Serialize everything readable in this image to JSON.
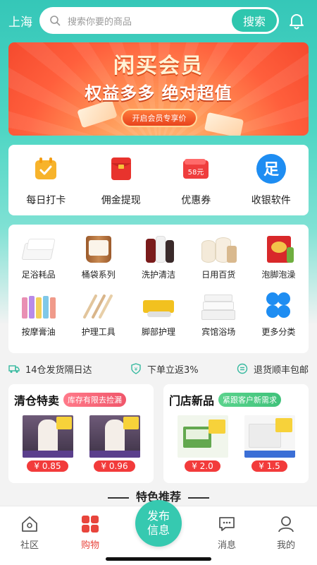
{
  "header": {
    "city": "上海",
    "search_placeholder": "搜索你要的商品",
    "search_button": "搜索"
  },
  "banner": {
    "title": "闲买会员",
    "subtitle": "权益多多 绝对超值",
    "button": "开启会员专享价"
  },
  "quick_actions": [
    {
      "label": "每日打卡",
      "icon": "calendar-check-icon"
    },
    {
      "label": "佣金提现",
      "icon": "red-envelope-icon"
    },
    {
      "label": "优惠券",
      "icon": "coupon-icon",
      "badge": "58元"
    },
    {
      "label": "收银软件",
      "icon": "cashier-icon",
      "badge": "足"
    }
  ],
  "categories": [
    {
      "label": "足浴耗品"
    },
    {
      "label": "桶袋系列"
    },
    {
      "label": "洗护清洁"
    },
    {
      "label": "日用百货"
    },
    {
      "label": "泡脚泡澡"
    },
    {
      "label": "按摩膏油"
    },
    {
      "label": "护理工具"
    },
    {
      "label": "脚部护理"
    },
    {
      "label": "宾馆浴场"
    },
    {
      "label": "更多分类"
    }
  ],
  "services": [
    {
      "label": "14仓发货隔日达",
      "icon": "truck-icon"
    },
    {
      "label": "下单立返3%",
      "icon": "shield-icon"
    },
    {
      "label": "退货顺丰包邮",
      "icon": "return-icon"
    }
  ],
  "promos": [
    {
      "title": "清仓特卖",
      "tag": "库存有限去捡漏",
      "tag_color": "#f0566a",
      "items": [
        {
          "price": "¥ 0.85"
        },
        {
          "price": "¥ 0.96"
        }
      ]
    },
    {
      "title": "门店新品",
      "tag": "紧跟客户新需求",
      "tag_color": "#3fc27a",
      "items": [
        {
          "price": "¥ 2.0"
        },
        {
          "price": "¥ 1.5"
        }
      ]
    }
  ],
  "section_title": "特色推荐",
  "tabbar": {
    "tabs": [
      {
        "label": "社区",
        "icon": "home-icon"
      },
      {
        "label": "购物",
        "icon": "grid-icon",
        "active": true
      },
      {
        "label": "消息",
        "icon": "message-icon"
      },
      {
        "label": "我的",
        "icon": "user-icon"
      }
    ],
    "publish_line1": "发布",
    "publish_line2": "信息"
  },
  "colors": {
    "accent": "#36c9b0",
    "price_red": "#f23b3b",
    "active_tab": "#e8453c"
  }
}
